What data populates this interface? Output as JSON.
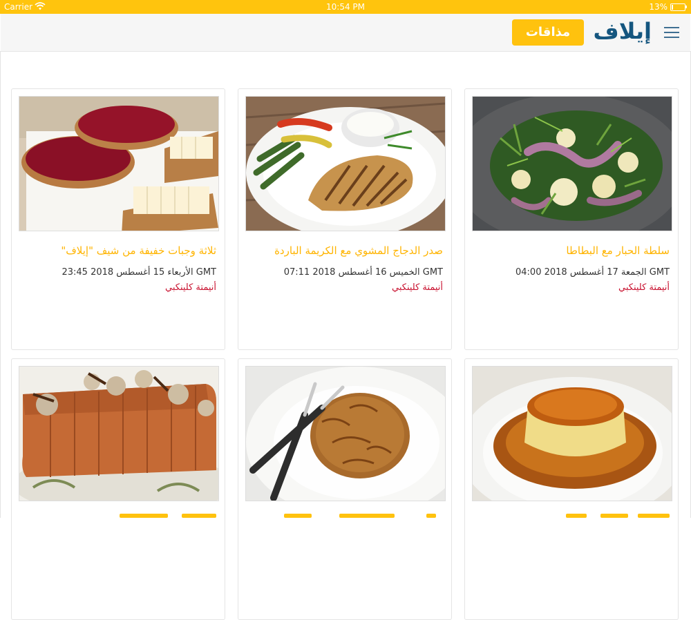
{
  "status_bar": {
    "carrier": "Carrier",
    "time": "10:54 PM",
    "battery": "13%",
    "battery_level": 0.13,
    "wifi_icon": "wifi-icon"
  },
  "header": {
    "logo": "إيلاف",
    "tastes_button": "مذاقات",
    "menu_icon": "hamburger-menu-icon",
    "accent_color": "#ffc20e",
    "brand_color": "#15567f"
  },
  "articles": [
    {
      "title": "سلطة الحبار مع البطاطا",
      "date": "GMT الجمعة 17 أغسطس 2018 04:00",
      "author": "أنيمتة كلينكبي",
      "image": "octopus-potato-salad-photo"
    },
    {
      "title": "صدر الدجاج المشوي مع الكريمة الباردة",
      "date": "GMT الخميس 16 أغسطس 2018 07:11",
      "author": "أنيمتة كلينكبي",
      "image": "grilled-chicken-breast-photo"
    },
    {
      "title": "ثلاثة وجبات خفيفة من شيف \"إيلاف\"",
      "date": "GMT الأربعاء 15 أغسطس 2018 23:45",
      "author": "أنيمتة كلينكبي",
      "image": "jam-toast-cheese-photo"
    },
    {
      "image": "caramel-flan-photo"
    },
    {
      "image": "potato-rosti-photo"
    },
    {
      "image": "fig-loaf-cake-photo"
    }
  ]
}
